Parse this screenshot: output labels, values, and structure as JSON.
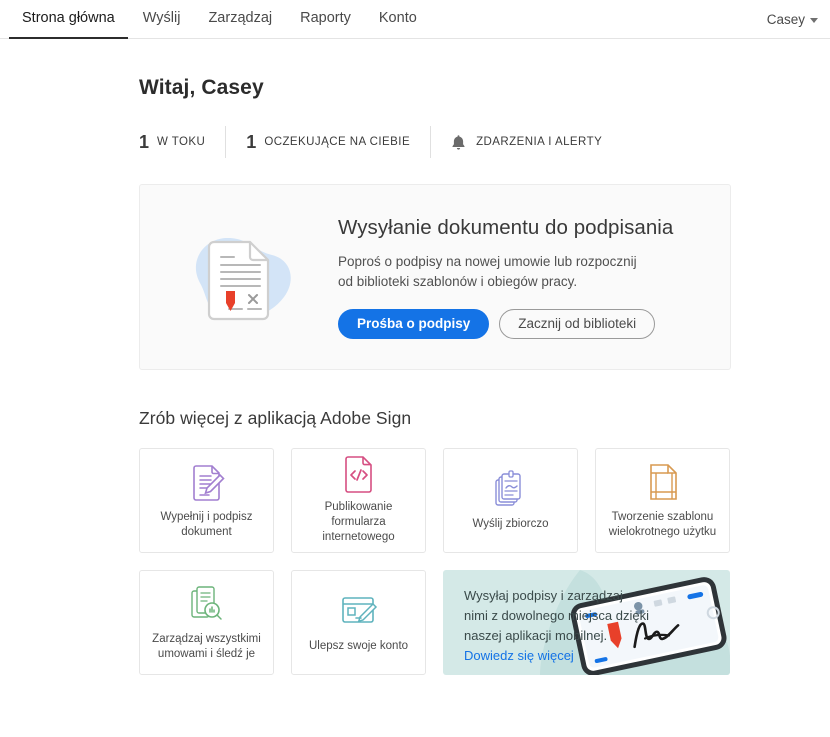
{
  "nav": {
    "items": [
      {
        "label": "Strona główna",
        "active": true
      },
      {
        "label": "Wyślij",
        "active": false
      },
      {
        "label": "Zarządzaj",
        "active": false
      },
      {
        "label": "Raporty",
        "active": false
      },
      {
        "label": "Konto",
        "active": false
      }
    ],
    "account": "Casey"
  },
  "greeting": "Witaj, Casey",
  "stats": [
    {
      "count": "1",
      "label": "W TOKU",
      "icon": ""
    },
    {
      "count": "1",
      "label": "OCZEKUJĄCE NA CIEBIE",
      "icon": ""
    },
    {
      "count": "",
      "label": "ZDARZENIA I ALERTY",
      "icon": "bell-icon"
    }
  ],
  "hero": {
    "illustration": "document-signature-icon",
    "title": "Wysyłanie dokumentu do podpisania",
    "description": "Poproś o podpisy na nowej umowie lub rozpocznij od biblioteki szablonów i obiegów pracy.",
    "primary_button": "Prośba o podpisy",
    "secondary_button": "Zacznij od biblioteki"
  },
  "section": {
    "title": "Zrób więcej z aplikacją Adobe Sign",
    "tiles": [
      {
        "label": "Wypełnij i podpisz dokument",
        "icon": "fill-and-sign-icon",
        "color": "#a27fd0"
      },
      {
        "label": "Publikowanie formularza internetowego",
        "icon": "web-form-code-icon",
        "color": "#d64f82"
      },
      {
        "label": "Wyślij zbiorczo",
        "icon": "send-in-bulk-icon",
        "color": "#8a8ed8"
      },
      {
        "label": "Tworzenie szablonu wielokrotnego użytku",
        "icon": "reusable-template-icon",
        "color": "#d89a51"
      },
      {
        "label": "Zarządzaj wszystkimi umowami i śledź je",
        "icon": "manage-agreements-icon",
        "color": "#6cb47a"
      },
      {
        "label": "Ulepsz swoje konto",
        "icon": "upgrade-account-icon",
        "color": "#5fb3bd"
      }
    ]
  },
  "promo": {
    "text": "Wysyłaj podpisy i zarządzaj nimi z dowolnego miejsca dzięki naszej aplikacji mobilnej. ",
    "link": "Dowiedz się więcej",
    "art": "mobile-phone-signature-icon",
    "background": "#d4e9e7"
  },
  "colors": {
    "accent_blue": "#1473e6",
    "promo_bg": "#d4e9e7",
    "hero_bg": "#fafafa",
    "signature_red": "#e8402a"
  }
}
